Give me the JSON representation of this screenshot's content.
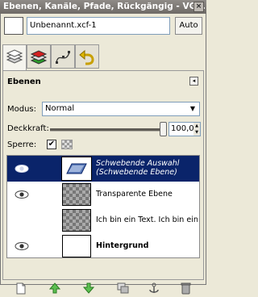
{
  "window": {
    "title": "Ebenen, Kanäle, Pfade, Rückgängig - VG/...",
    "close_glyph": "×"
  },
  "image_menu": {
    "value": "Unbenannt.xcf-1",
    "auto_label": "Auto"
  },
  "tabs": [
    {
      "name": "layers-tab",
      "active": true
    },
    {
      "name": "channels-tab",
      "active": false
    },
    {
      "name": "paths-tab",
      "active": false
    },
    {
      "name": "undo-tab",
      "active": false
    }
  ],
  "panel": {
    "title": "Ebenen",
    "mode_label": "Modus:",
    "mode_value": "Normal",
    "opacity_label": "Deckkraft:",
    "opacity_value": "100,0",
    "opacity_percent": 100,
    "lock_label": "Sperre:",
    "lock_pixels_checked": true
  },
  "layers": [
    {
      "name": "Schwebende Auswahl",
      "name2": "(Schwebende Ebene)",
      "visible": true,
      "selected": true,
      "thumb": "selection",
      "style": "italic"
    },
    {
      "name": "Transparente Ebene",
      "visible": true,
      "selected": false,
      "thumb": "checker",
      "style": "normal"
    },
    {
      "name": "Ich bin ein Text. Ich bin ein ...",
      "visible": false,
      "selected": false,
      "thumb": "checker",
      "style": "normal"
    },
    {
      "name": "Hintergrund",
      "visible": true,
      "selected": false,
      "thumb": "white",
      "style": "bold"
    }
  ],
  "bottom_buttons": [
    "new-layer-icon",
    "raise-layer-icon",
    "lower-layer-icon",
    "duplicate-layer-icon",
    "anchor-layer-icon",
    "delete-layer-icon"
  ]
}
